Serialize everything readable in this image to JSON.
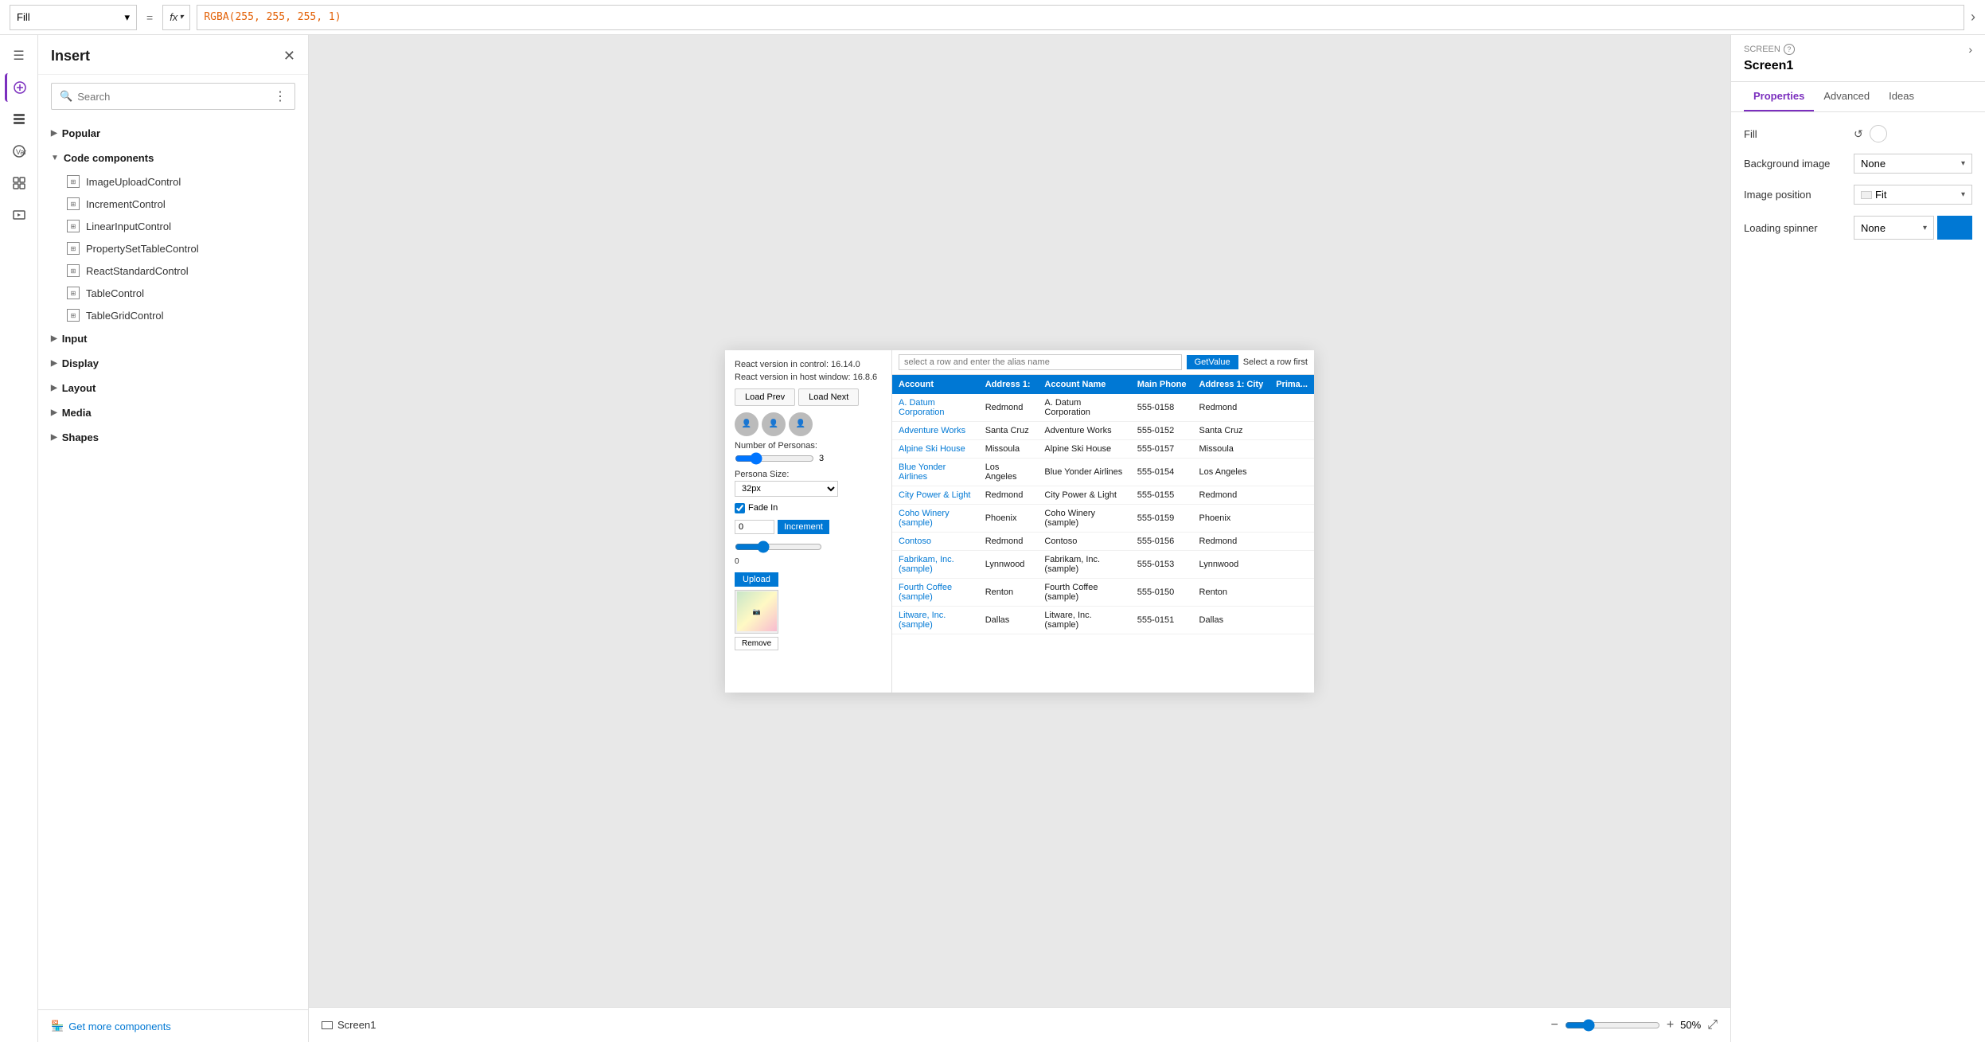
{
  "topbar": {
    "fill_label": "Fill",
    "equals": "=",
    "fx_label": "fx",
    "formula": "RGBA(255, 255, 255, 1)"
  },
  "insert_panel": {
    "title": "Insert",
    "search_placeholder": "Search",
    "sections": [
      {
        "id": "popular",
        "label": "Popular",
        "expanded": false
      },
      {
        "id": "code_components",
        "label": "Code components",
        "expanded": true
      }
    ],
    "components": [
      "ImageUploadControl",
      "IncrementControl",
      "LinearInputControl",
      "PropertySetTableControl",
      "ReactStandardControl",
      "TableControl",
      "TableGridControl"
    ],
    "collapsed_sections": [
      "Input",
      "Display",
      "Layout",
      "Media",
      "Shapes"
    ],
    "get_more_label": "Get more components"
  },
  "preview": {
    "react_version_control": "React version in control: 16.14.0",
    "react_version_host": "React version in host window: 16.8.6",
    "nav_prev": "Load Prev",
    "nav_next": "Load Next",
    "number_of_personas": "Number of Personas:",
    "slider_value": "3",
    "persona_size_label": "Persona Size:",
    "persona_size_value": "32px",
    "fade_in_label": "Fade In",
    "increment_value": "0",
    "increment_btn": "Increment",
    "upload_btn": "Upload",
    "remove_btn": "Remove",
    "alias_placeholder": "select a row and enter the alias name",
    "get_value_btn": "GetValue",
    "select_row_text": "Select a row first",
    "table_headers": [
      "Account",
      "Address 1:",
      "Account Name",
      "Main Phone",
      "Address 1: City",
      "Prima..."
    ],
    "table_rows": [
      {
        "account": "A. Datum Corporation",
        "address1": "Redmond",
        "account_name": "A. Datum Corporation",
        "phone": "555-0158",
        "city": "Redmond"
      },
      {
        "account": "Adventure Works",
        "address1": "Santa Cruz",
        "account_name": "Adventure Works",
        "phone": "555-0152",
        "city": "Santa Cruz"
      },
      {
        "account": "Alpine Ski House",
        "address1": "Missoula",
        "account_name": "Alpine Ski House",
        "phone": "555-0157",
        "city": "Missoula"
      },
      {
        "account": "Blue Yonder Airlines",
        "address1": "Los Angeles",
        "account_name": "Blue Yonder Airlines",
        "phone": "555-0154",
        "city": "Los Angeles"
      },
      {
        "account": "City Power & Light",
        "address1": "Redmond",
        "account_name": "City Power & Light",
        "phone": "555-0155",
        "city": "Redmond"
      },
      {
        "account": "Coho Winery (sample)",
        "address1": "Phoenix",
        "account_name": "Coho Winery (sample)",
        "phone": "555-0159",
        "city": "Phoenix"
      },
      {
        "account": "Contoso",
        "address1": "Redmond",
        "account_name": "Contoso",
        "phone": "555-0156",
        "city": "Redmond"
      },
      {
        "account": "Fabrikam, Inc. (sample)",
        "address1": "Lynnwood",
        "account_name": "Fabrikam, Inc. (sample)",
        "phone": "555-0153",
        "city": "Lynnwood"
      },
      {
        "account": "Fourth Coffee (sample)",
        "address1": "Renton",
        "account_name": "Fourth Coffee (sample)",
        "phone": "555-0150",
        "city": "Renton"
      },
      {
        "account": "Litware, Inc. (sample)",
        "address1": "Dallas",
        "account_name": "Litware, Inc. (sample)",
        "phone": "555-0151",
        "city": "Dallas"
      }
    ]
  },
  "bottom_bar": {
    "screen_name": "Screen1",
    "zoom_value": "50",
    "zoom_unit": "%"
  },
  "right_panel": {
    "screen_label": "SCREEN",
    "screen1_title": "Screen1",
    "tabs": [
      "Properties",
      "Advanced",
      "Ideas"
    ],
    "active_tab": "Properties",
    "fill_label": "Fill",
    "background_image_label": "Background image",
    "background_image_value": "None",
    "image_position_label": "Image position",
    "image_position_value": "Fit",
    "loading_spinner_label": "Loading spinner",
    "loading_spinner_value": "None"
  }
}
